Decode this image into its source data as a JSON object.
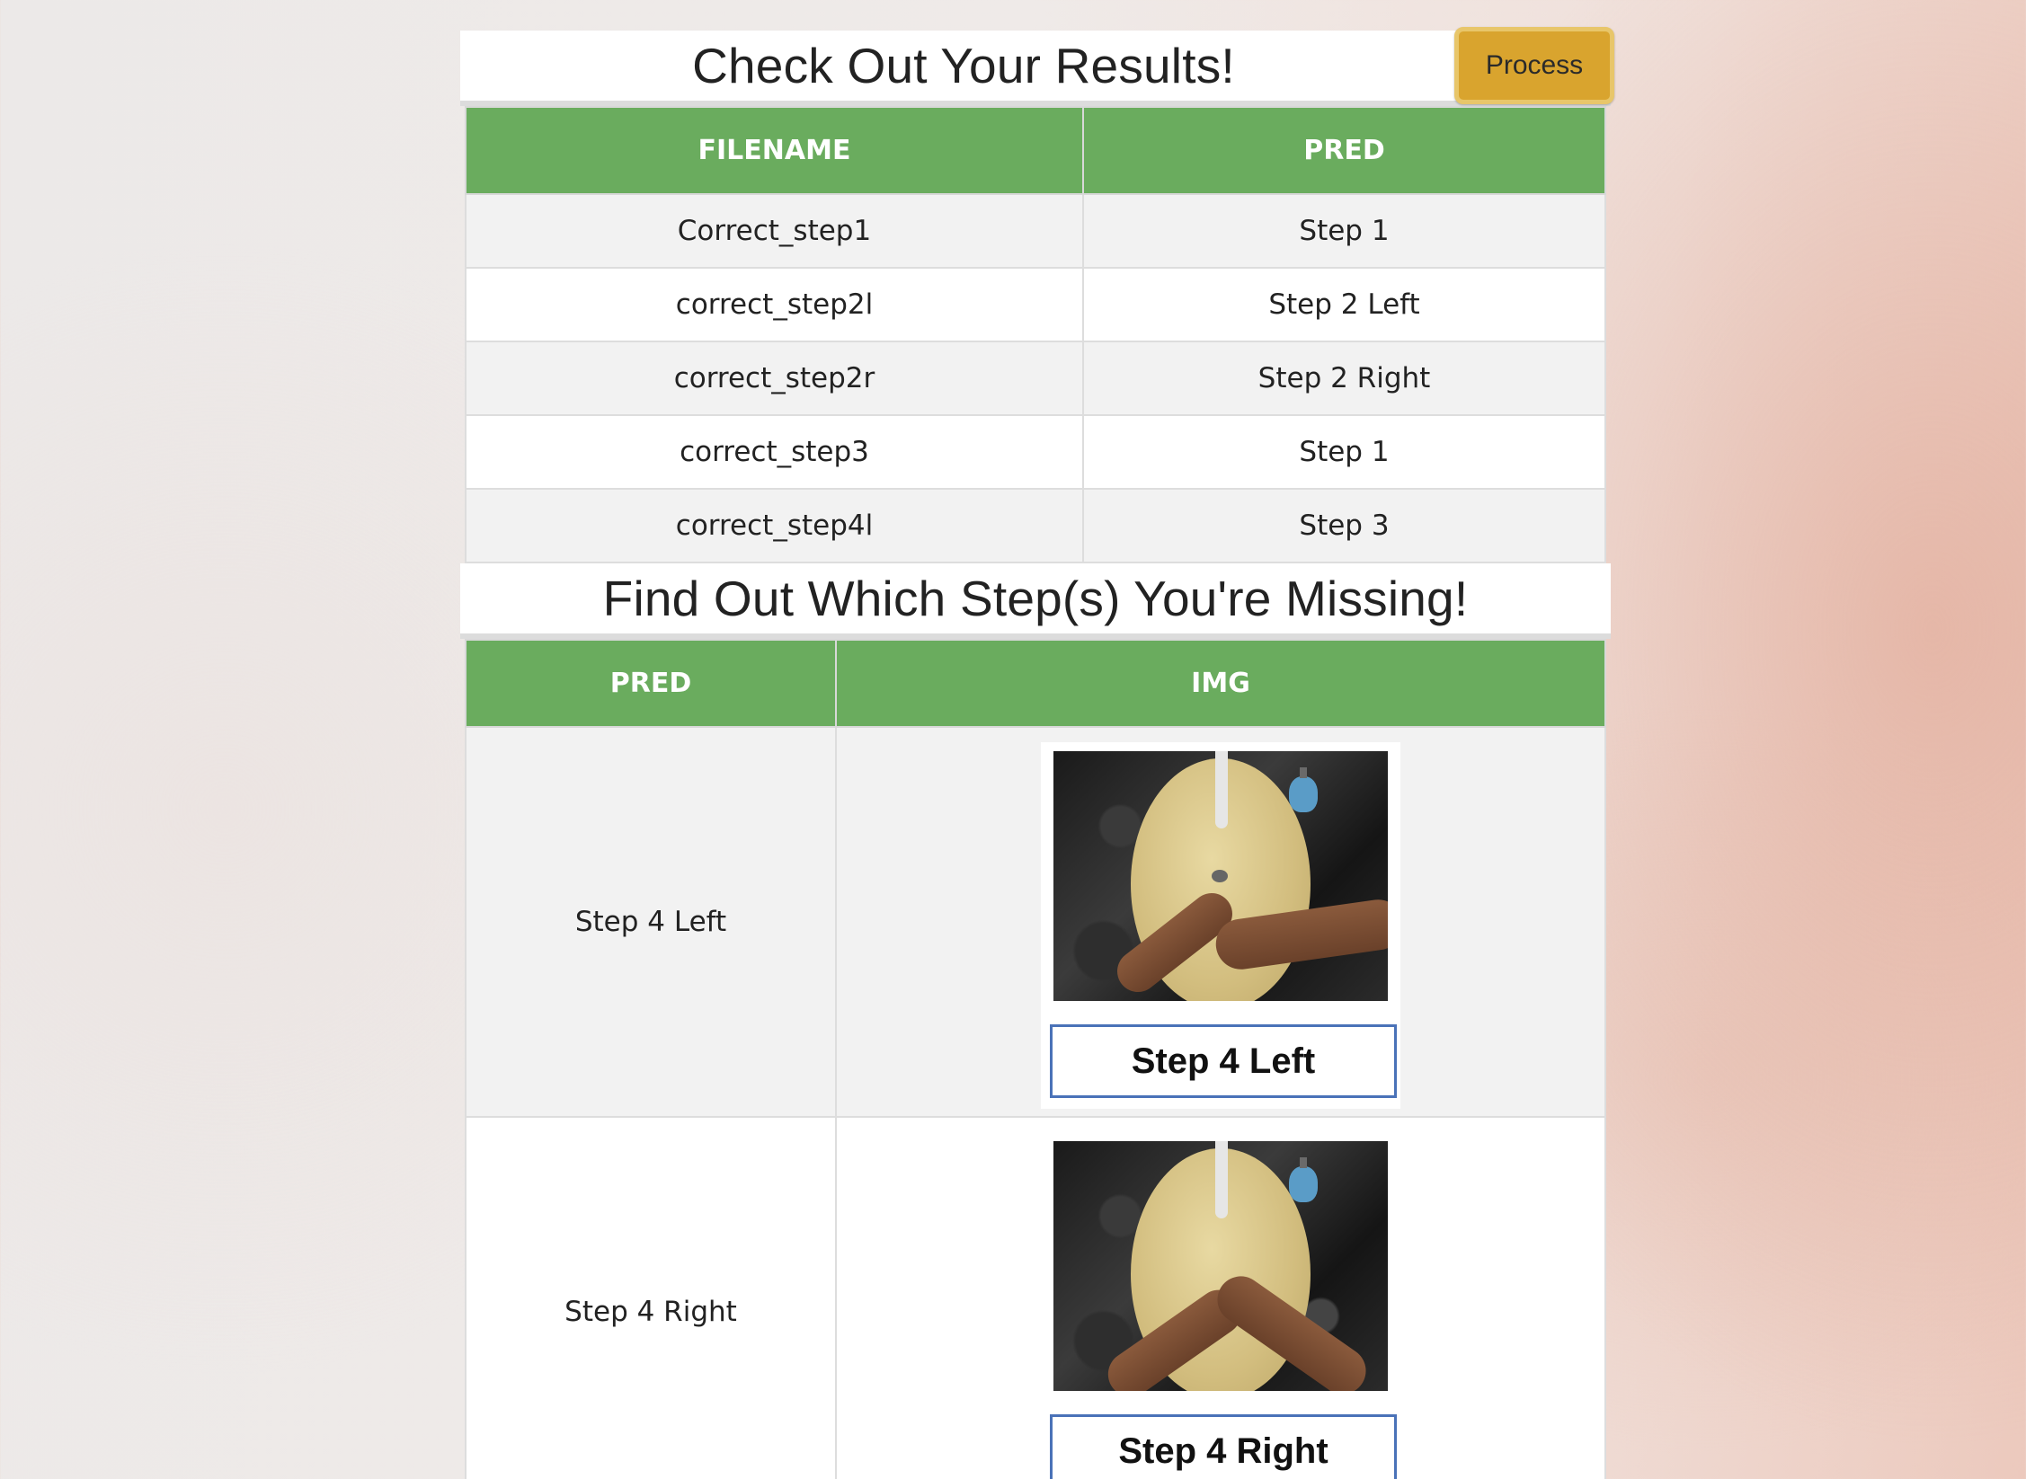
{
  "results": {
    "title": "Check Out Your Results!",
    "process_label": "Process",
    "headers": [
      "FILENAME",
      "PRED"
    ],
    "rows": [
      {
        "filename": "Correct_step1",
        "pred": "Step 1"
      },
      {
        "filename": "correct_step2l",
        "pred": "Step 2 Left"
      },
      {
        "filename": "correct_step2r",
        "pred": "Step 2 Right"
      },
      {
        "filename": "correct_step3",
        "pred": "Step 1"
      },
      {
        "filename": "correct_step4l",
        "pred": "Step 3"
      }
    ]
  },
  "missing": {
    "title": "Find Out Which Step(s) You're Missing!",
    "headers": [
      "PRED",
      "IMG"
    ],
    "rows": [
      {
        "pred": "Step 4 Left",
        "img_caption": "Step 4 Left"
      },
      {
        "pred": "Step 4 Right",
        "img_caption": "Step 4 Right"
      }
    ]
  },
  "colors": {
    "header_green": "#6aac5e",
    "process_button": "#d9a42e",
    "caption_border": "#4a72b8"
  }
}
